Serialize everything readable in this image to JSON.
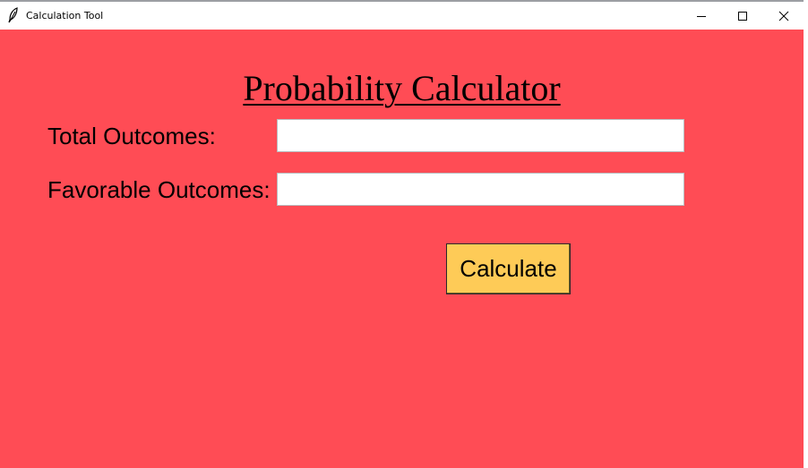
{
  "window": {
    "title": "Calculation Tool",
    "icon": "feather-icon",
    "controls": [
      "minimize-icon",
      "maximize-icon",
      "close-icon"
    ]
  },
  "main": {
    "heading": "Probability Calculator",
    "background_color": "#ff4c55",
    "fields": [
      {
        "label": "Total Outcomes:",
        "value": "",
        "placeholder": ""
      },
      {
        "label": "Favorable Outcomes:",
        "value": "",
        "placeholder": ""
      }
    ],
    "calculate_button": {
      "label": "Calculate",
      "color": "#fecb57"
    }
  }
}
